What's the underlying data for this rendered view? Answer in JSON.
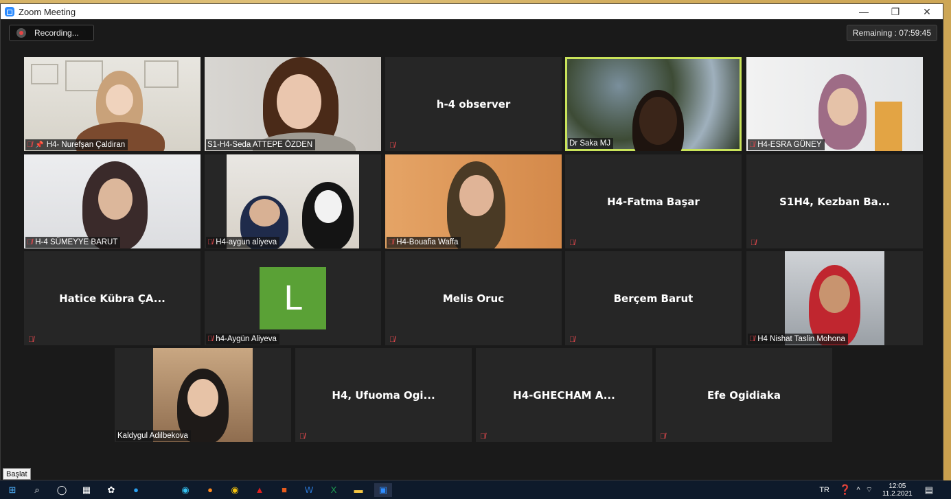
{
  "window": {
    "title": "Zoom Meeting",
    "minimize": "—",
    "maximize": "❐",
    "close": "✕"
  },
  "recording": {
    "label": "Recording..."
  },
  "remaining": {
    "label": "Remaining : 07:59:45"
  },
  "participants": [
    {
      "name": "H4- Nurefşan Çaldiran",
      "type": "video",
      "pinned": true
    },
    {
      "name": "S1-H4-Seda ATTEPE ÖZDEN",
      "type": "video"
    },
    {
      "name": "h-4 observer",
      "type": "name"
    },
    {
      "name": "Dr Saka MJ",
      "type": "video",
      "active": true
    },
    {
      "name": "H4-ESRA GÜNEY",
      "type": "video"
    },
    {
      "name": "H-4 SÜMEYYE BARUT",
      "type": "video"
    },
    {
      "name": "H4-aygun aliyeva",
      "type": "video"
    },
    {
      "name": "H4-Bouafia Waffa",
      "type": "video"
    },
    {
      "name": "H4-Fatma Başar",
      "type": "name"
    },
    {
      "name": "S1H4, Kezban Ba...",
      "type": "name"
    },
    {
      "name": "Hatice Kübra ÇA...",
      "type": "name"
    },
    {
      "name": "h4-Aygün Aliyeva",
      "type": "avatar",
      "initial": "L"
    },
    {
      "name": "Melis Oruc",
      "type": "name"
    },
    {
      "name": "Berçem Barut",
      "type": "name"
    },
    {
      "name": "H4 Nishat Taslin Mohona",
      "type": "video"
    },
    {
      "name": "Kaldygul Adilbekova",
      "type": "video"
    },
    {
      "name": "H4, Ufuoma Ogi...",
      "type": "name"
    },
    {
      "name": "H4-GHECHAM A...",
      "type": "name"
    },
    {
      "name": "Efe Ogidiaka",
      "type": "name"
    }
  ],
  "taskbar": {
    "start_tooltip": "Başlat",
    "language": "TR",
    "time": "12:05",
    "date": "11.2.2021"
  },
  "colors": {
    "active_speaker": "#c9e35a",
    "mic_muted": "#e5484d",
    "tile_bg": "#262626",
    "avatar_bg": "#5aa136"
  }
}
